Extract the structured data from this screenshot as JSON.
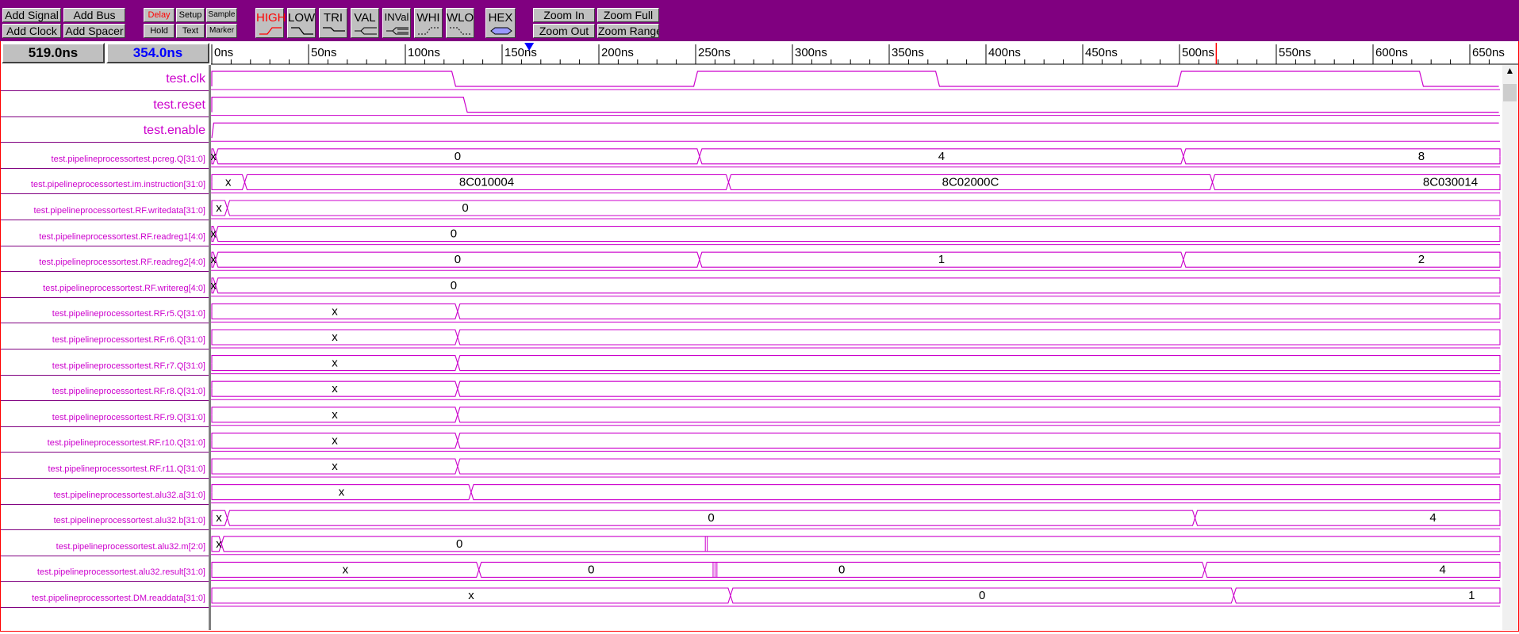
{
  "toolbar": {
    "add_signal": "Add Signal",
    "add_bus": "Add Bus",
    "add_clock": "Add Clock",
    "add_spacer": "Add Spacer",
    "delay": "Delay",
    "setup": "Setup",
    "sample": "Sample",
    "hold": "Hold",
    "text": "Text",
    "marker": "Marker",
    "high": "HIGH",
    "low": "LOW",
    "tri": "TRI",
    "val": "VAL",
    "inval": "INVal",
    "whi": "WHI",
    "wlo": "WLO",
    "hex": "HEX",
    "zoom_in": "Zoom In",
    "zoom_full": "Zoom Full",
    "zoom_out": "Zoom Out",
    "zoom_range": "Zoom Range"
  },
  "time": {
    "cursor": "519.0ns",
    "delta": "354.0ns"
  },
  "colors": {
    "toolbar_bg": "#800080",
    "wave": "#cc00cc",
    "marker": "#0000ff",
    "cursor_line": "#ff0000"
  },
  "ruler": {
    "labels": [
      "0ns",
      "50ns",
      "100ns",
      "150ns",
      "200ns",
      "250ns",
      "300ns",
      "350ns",
      "400ns",
      "450ns",
      "500ns",
      "550ns",
      "600ns",
      "650ns"
    ],
    "marker_ns": 164,
    "cursor_ns": 519
  },
  "signals": [
    {
      "name": "test.clk",
      "type": "bit",
      "edges": [
        [
          0,
          0
        ],
        [
          1,
          0
        ],
        [
          1,
          124
        ],
        [
          0,
          126
        ],
        [
          0,
          249
        ],
        [
          1,
          251
        ],
        [
          1,
          374
        ],
        [
          0,
          376
        ],
        [
          0,
          499
        ],
        [
          1,
          501
        ],
        [
          1,
          624
        ],
        [
          0,
          626
        ],
        [
          0,
          665
        ]
      ]
    },
    {
      "name": "test.reset",
      "type": "bit",
      "edges": [
        [
          0,
          0
        ],
        [
          1,
          0
        ],
        [
          1,
          130
        ],
        [
          0,
          132
        ],
        [
          0,
          665
        ]
      ]
    },
    {
      "name": "test.enable",
      "type": "bit",
      "edges": [
        [
          0,
          0
        ],
        [
          1,
          1
        ],
        [
          1,
          665
        ]
      ]
    },
    {
      "name": "test.pipelineprocessortest.pcreg.Q[31:0]",
      "type": "bus",
      "segments": [
        {
          "s": 0,
          "v": "x"
        },
        {
          "s": 2,
          "v": "0"
        },
        {
          "s": 252,
          "v": "4"
        },
        {
          "s": 502,
          "v": "8"
        }
      ]
    },
    {
      "name": "test.pipelineprocessortest.im.instruction[31:0]",
      "type": "bus",
      "segments": [
        {
          "s": 0,
          "v": "x"
        },
        {
          "s": 17,
          "v": "8C010004"
        },
        {
          "s": 267,
          "v": "8C02000C"
        },
        {
          "s": 517,
          "v": "8C030014"
        }
      ]
    },
    {
      "name": "test.pipelineprocessortest.RF.writedata[31:0]",
      "type": "bus",
      "segments": [
        {
          "s": 0,
          "v": "x"
        },
        {
          "s": 8,
          "v": "0"
        }
      ]
    },
    {
      "name": "test.pipelineprocessortest.RF.readreg1[4:0]",
      "type": "bus",
      "segments": [
        {
          "s": 0,
          "v": "x"
        },
        {
          "s": 2,
          "v": "0"
        }
      ]
    },
    {
      "name": "test.pipelineprocessortest.RF.readreg2[4:0]",
      "type": "bus",
      "segments": [
        {
          "s": 0,
          "v": "x"
        },
        {
          "s": 2,
          "v": "0"
        },
        {
          "s": 252,
          "v": "1"
        },
        {
          "s": 502,
          "v": "2"
        }
      ]
    },
    {
      "name": "test.pipelineprocessortest.RF.writereg[4:0]",
      "type": "bus",
      "segments": [
        {
          "s": 0,
          "v": "x"
        },
        {
          "s": 2,
          "v": "0"
        }
      ]
    },
    {
      "name": "test.pipelineprocessortest.RF.r5.Q[31:0]",
      "type": "bus",
      "segments": [
        {
          "s": 0,
          "v": "x"
        },
        {
          "s": 127,
          "v": ""
        }
      ]
    },
    {
      "name": "test.pipelineprocessortest.RF.r6.Q[31:0]",
      "type": "bus",
      "segments": [
        {
          "s": 0,
          "v": "x"
        },
        {
          "s": 127,
          "v": ""
        }
      ]
    },
    {
      "name": "test.pipelineprocessortest.RF.r7.Q[31:0]",
      "type": "bus",
      "segments": [
        {
          "s": 0,
          "v": "x"
        },
        {
          "s": 127,
          "v": ""
        }
      ]
    },
    {
      "name": "test.pipelineprocessortest.RF.r8.Q[31:0]",
      "type": "bus",
      "segments": [
        {
          "s": 0,
          "v": "x"
        },
        {
          "s": 127,
          "v": ""
        }
      ]
    },
    {
      "name": "test.pipelineprocessortest.RF.r9.Q[31:0]",
      "type": "bus",
      "segments": [
        {
          "s": 0,
          "v": "x"
        },
        {
          "s": 127,
          "v": ""
        }
      ]
    },
    {
      "name": "test.pipelineprocessortest.RF.r10.Q[31:0]",
      "type": "bus",
      "segments": [
        {
          "s": 0,
          "v": "x"
        },
        {
          "s": 127,
          "v": ""
        }
      ]
    },
    {
      "name": "test.pipelineprocessortest.RF.r11.Q[31:0]",
      "type": "bus",
      "segments": [
        {
          "s": 0,
          "v": "x"
        },
        {
          "s": 127,
          "v": ""
        }
      ]
    },
    {
      "name": "test.pipelineprocessortest.alu32.a[31:0]",
      "type": "bus",
      "segments": [
        {
          "s": 0,
          "v": "x"
        },
        {
          "s": 134,
          "v": ""
        }
      ]
    },
    {
      "name": "test.pipelineprocessortest.alu32.b[31:0]",
      "type": "bus",
      "segments": [
        {
          "s": 0,
          "v": "x"
        },
        {
          "s": 8,
          "v": "0"
        },
        {
          "s": 508,
          "v": "4"
        }
      ]
    },
    {
      "name": "test.pipelineprocessortest.alu32.m[2:0]",
      "type": "bus",
      "segments": [
        {
          "s": 0,
          "v": "x"
        },
        {
          "s": 5,
          "v": "0"
        }
      ],
      "glitches": [
        255,
        256
      ]
    },
    {
      "name": "test.pipelineprocessortest.alu32.result[31:0]",
      "type": "bus",
      "segments": [
        {
          "s": 0,
          "v": "x"
        },
        {
          "s": 138,
          "v": "0"
        },
        {
          "s": 513,
          "v": "4"
        }
      ],
      "glitches": [
        259,
        260,
        261
      ]
    },
    {
      "name": "test.pipelineprocessortest.DM.readdata[31:0]",
      "type": "bus",
      "segments": [
        {
          "s": 0,
          "v": "x"
        },
        {
          "s": 268,
          "v": "0"
        },
        {
          "s": 528,
          "v": "1"
        }
      ]
    }
  ],
  "extra_label": {
    "row": 19,
    "ns": 196,
    "v": "0"
  }
}
